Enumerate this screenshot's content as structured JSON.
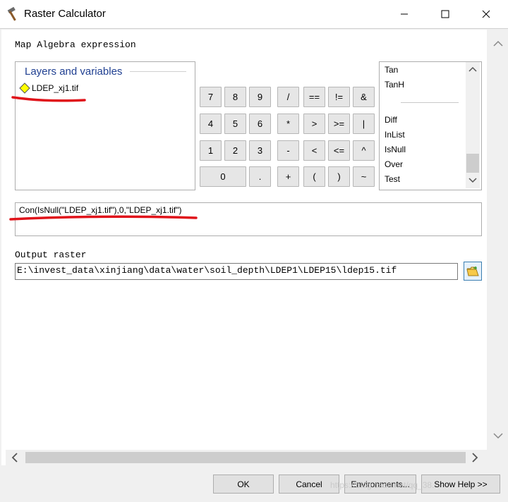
{
  "window": {
    "title": "Raster Calculator",
    "controls": {
      "minimize": "─",
      "maximize": "☐",
      "close": "✕"
    }
  },
  "expression_label": "Map Algebra expression",
  "layers": {
    "header": "Layers and variables",
    "items": [
      "LDEP_xj1.tif"
    ]
  },
  "calculator": {
    "rows": [
      [
        "7",
        "8",
        "9",
        "/",
        "==",
        "!=",
        "&"
      ],
      [
        "4",
        "5",
        "6",
        "*",
        ">",
        ">=",
        "|"
      ],
      [
        "1",
        "2",
        "3",
        "-",
        "<",
        "<=",
        "^"
      ],
      [
        "0",
        ".",
        "+",
        "(",
        ")",
        "~"
      ]
    ]
  },
  "functions": {
    "group1": [
      "Tan",
      "TanH"
    ],
    "group2": [
      "Diff",
      "InList",
      "IsNull",
      "Over",
      "Test"
    ]
  },
  "expression": "Con(IsNull(\"LDEP_xj1.tif\"),0,\"LDEP_xj1.tif\")",
  "output": {
    "label": "Output raster",
    "value": "E:\\invest_data\\xinjiang\\data\\water\\soil_depth\\LDEP1\\LDEP15\\ldep15.tif"
  },
  "buttons": {
    "ok": "OK",
    "cancel": "Cancel",
    "environments": "Environments...",
    "help": "Show Help >>"
  },
  "watermark": "https://blog.csdn.net/qq_38..."
}
